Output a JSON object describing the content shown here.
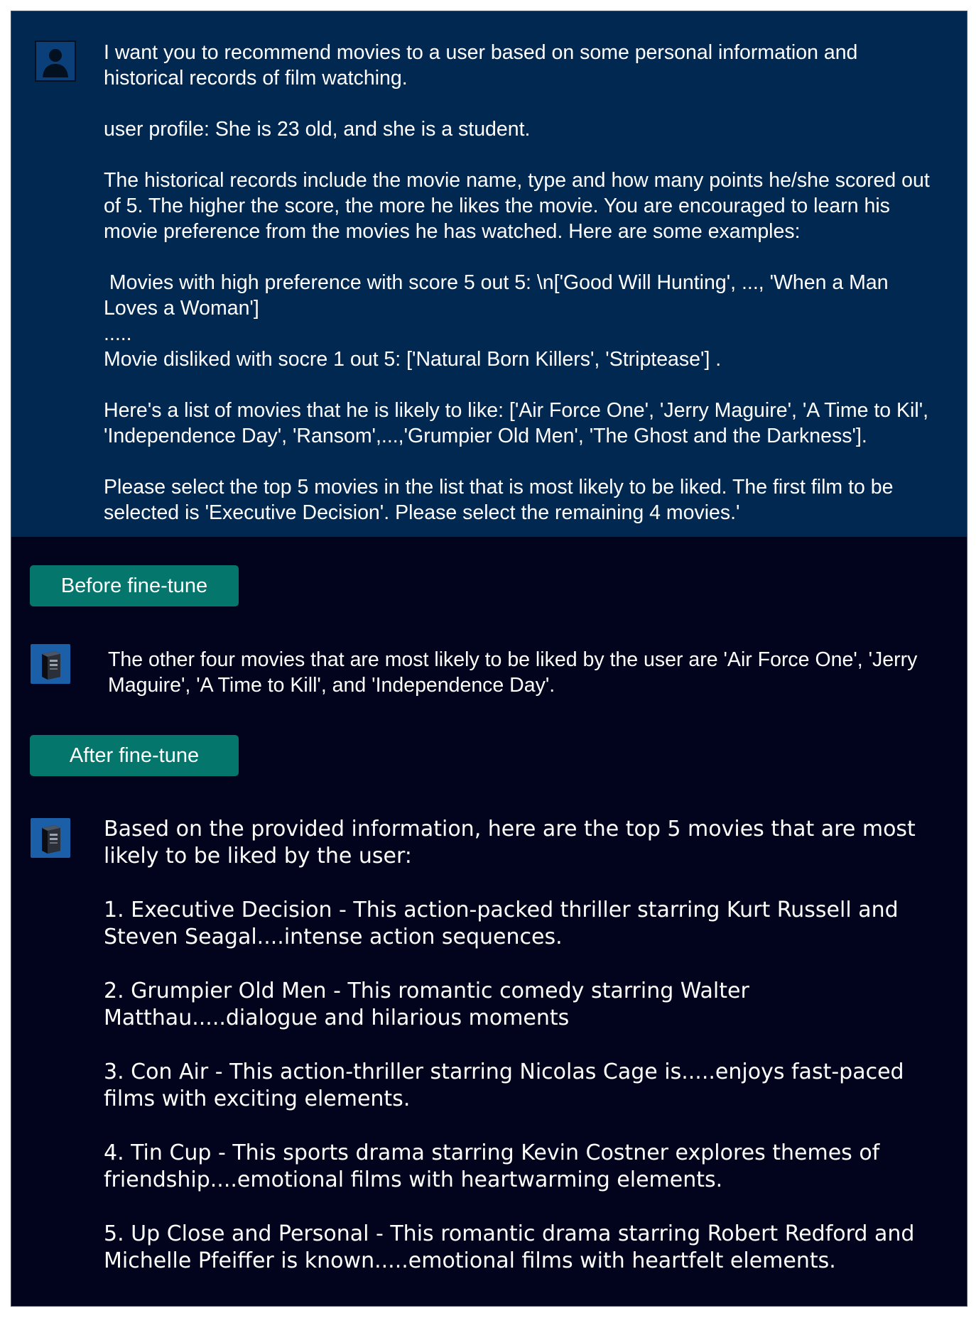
{
  "prompt": {
    "p1": "I want you to recommend movies to a user based on some personal information and historical records of film watching.",
    "p2": "user profile: She is 23 old, and she is a student.",
    "p3": "The historical records include the movie name, type and how many points he/she scored out of 5. The higher the score, the more he likes the movie. You are encouraged to learn his movie preference from the movies he has watched. Here are some examples:",
    "p4a": " Movies with high preference with score 5 out 5: \\n['Good Will Hunting', ..., 'When a Man Loves a Woman']",
    "p4b": ".....",
    "p4c": "Movie disliked with socre 1 out 5: ['Natural Born Killers', 'Striptease'] .",
    "p5": "Here's a list of movies that he is likely to like: ['Air Force One', 'Jerry Maguire', 'A Time to Kil', 'Independence Day', 'Ransom',...,'Grumpier Old Men', 'The Ghost and the Darkness'].",
    "p6": "Please select the top 5 movies in the list that is most likely to be liked.  The first film to be selected is 'Executive Decision'. Please select the remaining 4 movies.'"
  },
  "before": {
    "label": "Before fine-tune",
    "text": "The other four movies that are most likely to be liked by the user are 'Air Force One', 'Jerry Maguire', 'A Time to Kill', and 'Independence Day'."
  },
  "after": {
    "label": "After fine-tune",
    "intro": "Based on the provided information, here are the top 5 movies that are most likely to be liked by the user:",
    "items": [
      "1. Executive Decision - This action-packed thriller starring Kurt Russell and Steven Seagal....intense action sequences.",
      "2. Grumpier Old Men - This romantic comedy starring Walter Matthau.....dialogue and hilarious moments",
      "3. Con Air - This action-thriller starring Nicolas Cage is.....enjoys fast-paced films with exciting elements.",
      "4. Tin Cup - This sports drama starring Kevin Costner explores themes of friendship....emotional films with heartwarming elements.",
      "5. Up Close and Personal - This romantic drama starring Robert Redford and Michelle Pfeiffer is known.....emotional films with heartfelt elements."
    ]
  },
  "icons": {
    "user": "user-avatar-icon",
    "bot": "computer-tower-icon"
  }
}
